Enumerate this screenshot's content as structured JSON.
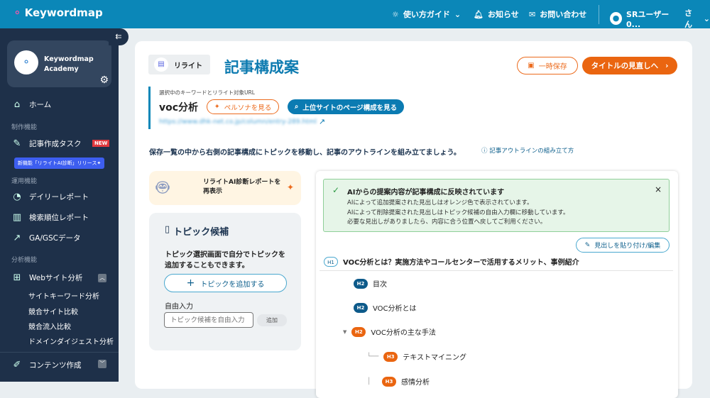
{
  "topbar": {
    "brand": "Keywordmap",
    "guide": "使い方ガイド",
    "news": "お知らせ",
    "contact": "お問い合わせ",
    "user": "SRユーザー0...",
    "user_suffix": "さん"
  },
  "sidebar": {
    "account": {
      "line1": "Keywordmap",
      "line2": "Academy"
    },
    "home": "ホーム",
    "section_create": "制作機能",
    "article_task": "記事作成タスク",
    "new_badge": "NEW",
    "tooltip": "新機能「リライトAI診断」リリース✦",
    "section_ops": "運用機能",
    "daily": "デイリーレポート",
    "rank": "検索順位レポート",
    "ga": "GA/GSCデータ",
    "section_analysis": "分析機能",
    "web": "Webサイト分析",
    "sub": [
      "サイトキーワード分析",
      "競合サイト比較",
      "競合流入比較",
      "ドメインダイジェスト分析"
    ],
    "content": "コンテンツ作成"
  },
  "main": {
    "crumb": "リライト",
    "title": "記事構成案",
    "save": "一時保存",
    "next": "タイトルの見直しへ",
    "kw_label": "選択中のキーワードとリライト対象URL",
    "keyword": "voc分析",
    "persona": "ペルソナを見る",
    "top_sites": "上位サイトのページ構成を見る",
    "url": "https://www.dhk-net.co.jp/column/entry-289.html",
    "instruction": "保存一覧の中から右側の記事構成にトピックを移動し、記事のアウトラインを組み立てましょう。",
    "howto": "記事アウトラインの組み立て方",
    "ai_report": "リライトAI診断レポートを再表示",
    "topics": {
      "title": "トピック候補",
      "desc": "トピック選択画面で自分でトピックを追加することもできます。",
      "add": "トピックを追加する",
      "free_label": "自由入力",
      "placeholder": "トピック候補を自由入力",
      "add_small": "追加"
    },
    "alert": {
      "title": "AIからの提案内容が記事構成に反映されています",
      "lines": [
        "AIによって追加提案された見出しはオレンジ色で表示されています。",
        "AIによって削除提案された見出しはトピック候補の自由入力欄に移動しています。",
        "必要な見出しがありましたら、内容に合う位置へ戻してご利用ください。"
      ]
    },
    "paste": "見出しを貼り付け/編集",
    "h1": {
      "tag": "H1",
      "text": "VOC分析とは？実施方法やコールセンターで活用するメリット、事例紹介"
    },
    "headings": [
      {
        "tag": "H2",
        "text": "目次"
      },
      {
        "tag": "H2",
        "text": "VOC分析とは"
      },
      {
        "tag": "H2",
        "text": "VOC分析の主な手法"
      },
      {
        "tag": "H3",
        "text": "テキストマイニング"
      },
      {
        "tag": "H3",
        "text": "感情分析"
      }
    ]
  },
  "colors": {
    "topbar": "#0b87b8",
    "sidebar": "#1e3049",
    "accent_orange": "#ea6510",
    "h2_blue": "#0d5a8a"
  }
}
